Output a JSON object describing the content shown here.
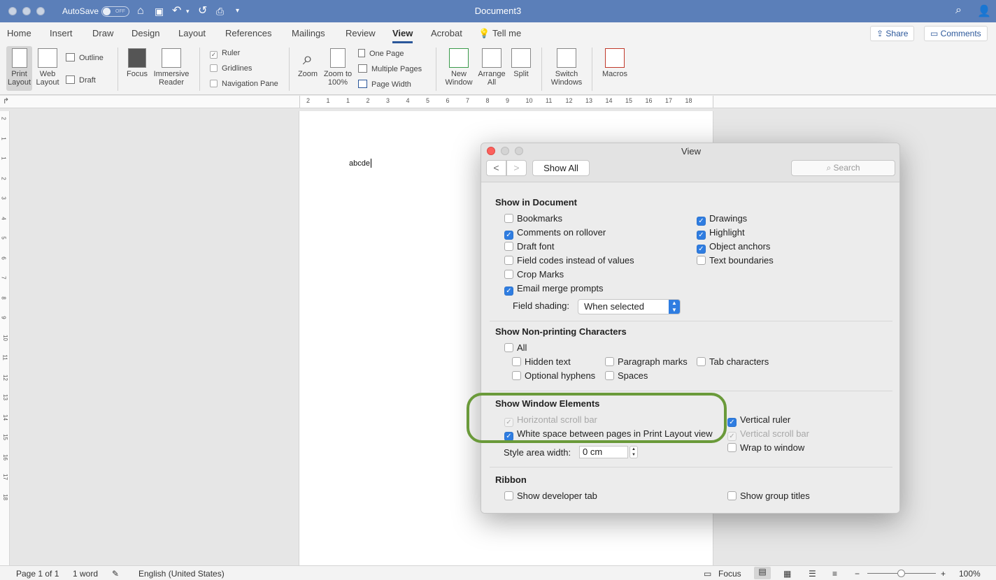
{
  "titlebar": {
    "autosave_label": "AutoSave",
    "autosave_state": "OFF",
    "doc_title": "Document3"
  },
  "tabs": [
    "Home",
    "Insert",
    "Draw",
    "Design",
    "Layout",
    "References",
    "Mailings",
    "Review",
    "View",
    "Acrobat",
    "Tell me"
  ],
  "active_tab": "View",
  "share_label": "Share",
  "comments_label": "Comments",
  "ribbon": {
    "print_layout": "Print Layout",
    "web_layout": "Web Layout",
    "outline": "Outline",
    "draft": "Draft",
    "focus": "Focus",
    "immersive_reader": "Immersive Reader",
    "ruler": "Ruler",
    "gridlines": "Gridlines",
    "navigation_pane": "Navigation Pane",
    "zoom": "Zoom",
    "zoom_100": "Zoom to 100%",
    "one_page": "One Page",
    "multiple_pages": "Multiple Pages",
    "page_width": "Page Width",
    "new_window": "New Window",
    "arrange_all": "Arrange All",
    "split": "Split",
    "switch_windows": "Switch Windows",
    "macros": "Macros"
  },
  "hruler_numbers": [
    "2",
    "1",
    "1",
    "2",
    "3",
    "4",
    "5",
    "6",
    "7",
    "8",
    "9",
    "10",
    "11",
    "12",
    "13",
    "14",
    "15",
    "16",
    "17",
    "18"
  ],
  "vruler_numbers": [
    "2",
    "1",
    "1",
    "2",
    "3",
    "4",
    "5",
    "6",
    "7",
    "8",
    "9",
    "10",
    "11",
    "12",
    "13",
    "14",
    "15",
    "16",
    "17",
    "18"
  ],
  "document": {
    "text": "abcde"
  },
  "dialog": {
    "title": "View",
    "back": "<",
    "forward": ">",
    "show_all": "Show All",
    "search_placeholder": "Search",
    "show_in_document": {
      "title": "Show in Document",
      "left": [
        {
          "label": "Bookmarks",
          "checked": false
        },
        {
          "label": "Comments on rollover",
          "checked": true
        },
        {
          "label": "Draft font",
          "checked": false
        },
        {
          "label": "Field codes instead of values",
          "checked": false
        },
        {
          "label": "Crop Marks",
          "checked": false
        },
        {
          "label": "Email merge prompts",
          "checked": true
        }
      ],
      "right": [
        {
          "label": "Drawings",
          "checked": true
        },
        {
          "label": "Highlight",
          "checked": true
        },
        {
          "label": "Object anchors",
          "checked": true
        },
        {
          "label": "Text boundaries",
          "checked": false
        }
      ],
      "field_shading_label": "Field shading:",
      "field_shading_value": "When selected"
    },
    "non_printing": {
      "title": "Show Non-printing Characters",
      "all": "All",
      "hidden_text": "Hidden text",
      "paragraph_marks": "Paragraph marks",
      "tab_characters": "Tab characters",
      "optional_hyphens": "Optional hyphens",
      "spaces": "Spaces"
    },
    "window_elements": {
      "title": "Show Window Elements",
      "horizontal_scroll": "Horizontal scroll bar",
      "white_space": "White space between pages in Print Layout view",
      "vertical_ruler": "Vertical ruler",
      "vertical_scroll": "Vertical scroll bar",
      "wrap_to_window": "Wrap to window",
      "style_area_label": "Style area width:",
      "style_area_value": "0 cm"
    },
    "ribbon": {
      "title": "Ribbon",
      "developer_tab": "Show developer tab",
      "group_titles": "Show group titles"
    }
  },
  "status": {
    "page": "Page 1 of 1",
    "words": "1 word",
    "language": "English (United States)",
    "focus": "Focus",
    "zoom": "100%",
    "zoom_level": 100
  },
  "colors": {
    "titlebar": "#5b7fb9",
    "accent": "#2f7de1",
    "highlight_ring": "#6a9a3a"
  }
}
